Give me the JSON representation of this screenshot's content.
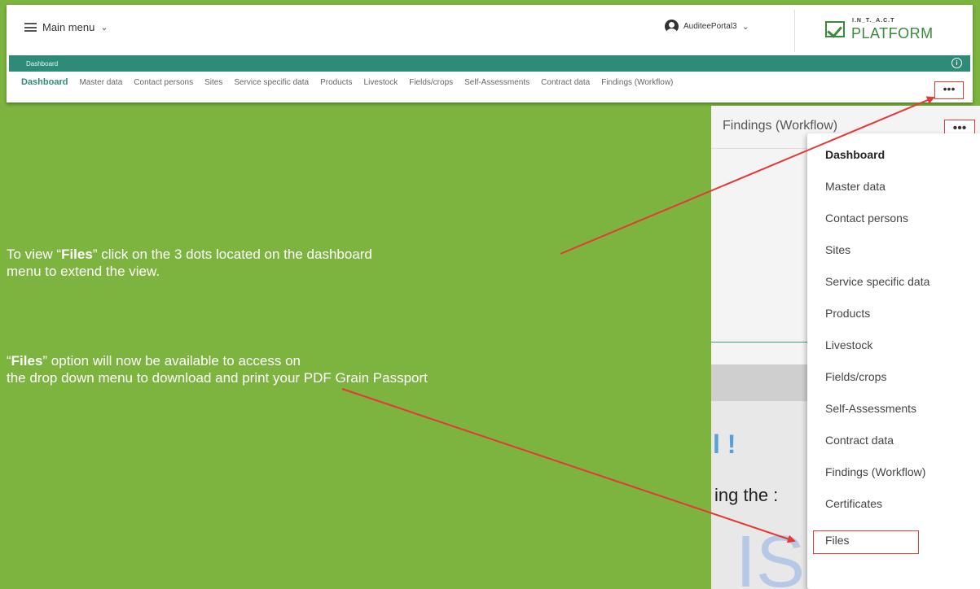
{
  "app": {
    "main_menu_label": "Main menu",
    "user_name": "AuditeePortal3",
    "logo_small": "I.N_T._A.C.T",
    "logo_big": "PLATFORM",
    "breadcrumb": "Dashboard",
    "tabs": [
      "Dashboard",
      "Master data",
      "Contact persons",
      "Sites",
      "Service specific data",
      "Products",
      "Livestock",
      "Fields/crops",
      "Self-Assessments",
      "Contract data",
      "Findings (Workflow)"
    ],
    "more_label": "•••"
  },
  "panel": {
    "title": "Findings (Workflow)",
    "more_label": "•••",
    "menu_items": [
      "Dashboard",
      "Master data",
      "Contact persons",
      "Sites",
      "Service specific data",
      "Products",
      "Livestock",
      "Fields/crops",
      "Self-Assessments",
      "Contract data",
      "Findings (Workflow)",
      "Certificates",
      "Files"
    ],
    "background_text": [
      "l !",
      "ing the :",
      "IS"
    ]
  },
  "instructions": {
    "step1_pre": "To view “",
    "step1_bold": "Files",
    "step1_post": "” click on the 3 dots located on the dashboard",
    "step1_line2": "menu to extend the view.",
    "step2_pre": "“",
    "step2_bold": "Files",
    "step2_post": "” option will now be available to access on",
    "step2_line2": "the drop down menu to download and print your PDF Grain Passport"
  },
  "colors": {
    "background": "#7db33f",
    "accent": "#2e8b78",
    "highlight": "#e53935",
    "brand": "#3a8a3a"
  }
}
